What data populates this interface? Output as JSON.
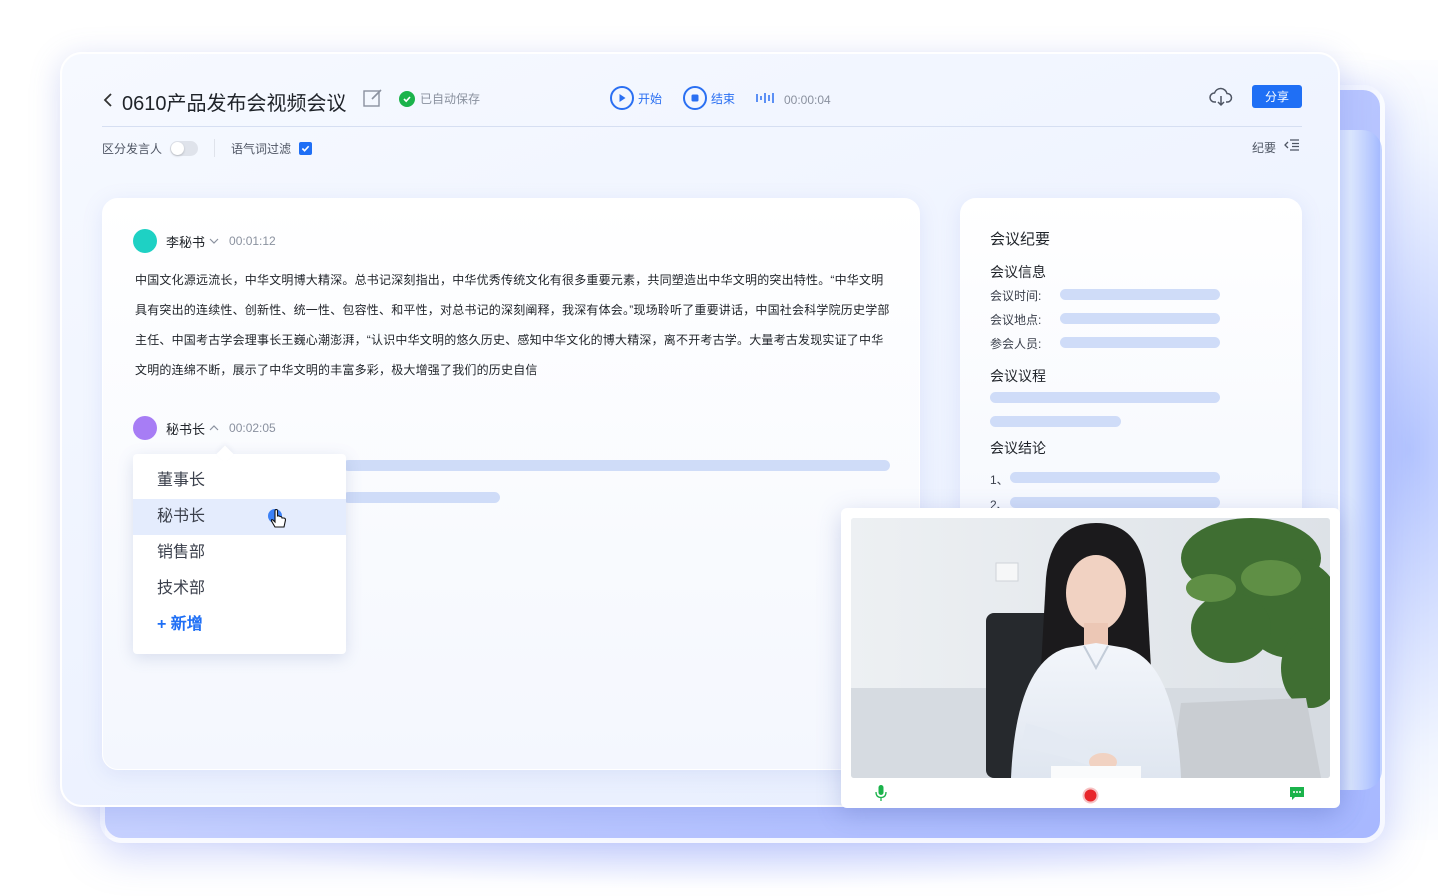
{
  "header": {
    "back_icon": "chevron-left-icon",
    "title": "0610产品发布会视频会议",
    "save_status": "已自动保存",
    "start_label": "开始",
    "end_label": "结束",
    "timer": "00:00:04",
    "share_label": "分享"
  },
  "toolbar": {
    "distinguish_speaker_label": "区分发言人",
    "distinguish_speaker_on": false,
    "filler_filter_label": "语气词过滤",
    "filler_filter_on": true,
    "summary_toggle_label": "纪要"
  },
  "transcript": {
    "entries": [
      {
        "speaker": "李秘书",
        "time": "00:01:12",
        "avatar_color": "#1ed1c4",
        "text": "中国文化源远流长，中华文明博大精深。总书记深刻指出，中华优秀传统文化有很多重要元素，共同塑造出中华文明的突出特性。“中华文明具有突出的连续性、创新性、统一性、包容性、和平性，对总书记的深刻阐释，我深有体会。”现场聆听了重要讲话，中国社会科学院历史学部主任、中国考古学会理事长王巍心潮澎湃，“认识中华文明的悠久历史、感知中华文化的博大精深，离不开考古学。大量考古发现实证了中华文明的连绵不断，展示了中华文明的丰富多彩，极大增强了我们的历史自信"
      },
      {
        "speaker": "秘书长",
        "time": "00:02:05",
        "avatar_color": "#a77df5"
      }
    ],
    "speaker_dropdown": {
      "options": [
        "董事长",
        "秘书长",
        "销售部",
        "技术部"
      ],
      "selected": "秘书长",
      "add_label": "+ 新增"
    }
  },
  "summary": {
    "title": "会议纪要",
    "info_heading": "会议信息",
    "time_label": "会议时间:",
    "place_label": "会议地点:",
    "attendees_label": "参会人员:",
    "agenda_heading": "会议议程",
    "conclusion_heading": "会议结论",
    "conclusion_items": [
      "1、",
      "2、"
    ]
  },
  "video": {
    "mic_icon": "microphone-icon",
    "record_icon": "record-icon",
    "chat_icon": "chat-icon",
    "record_color": "#e8262b",
    "mic_color": "#1bb34b"
  },
  "colors": {
    "accent": "#1f6ff5",
    "success": "#1bb34b"
  }
}
